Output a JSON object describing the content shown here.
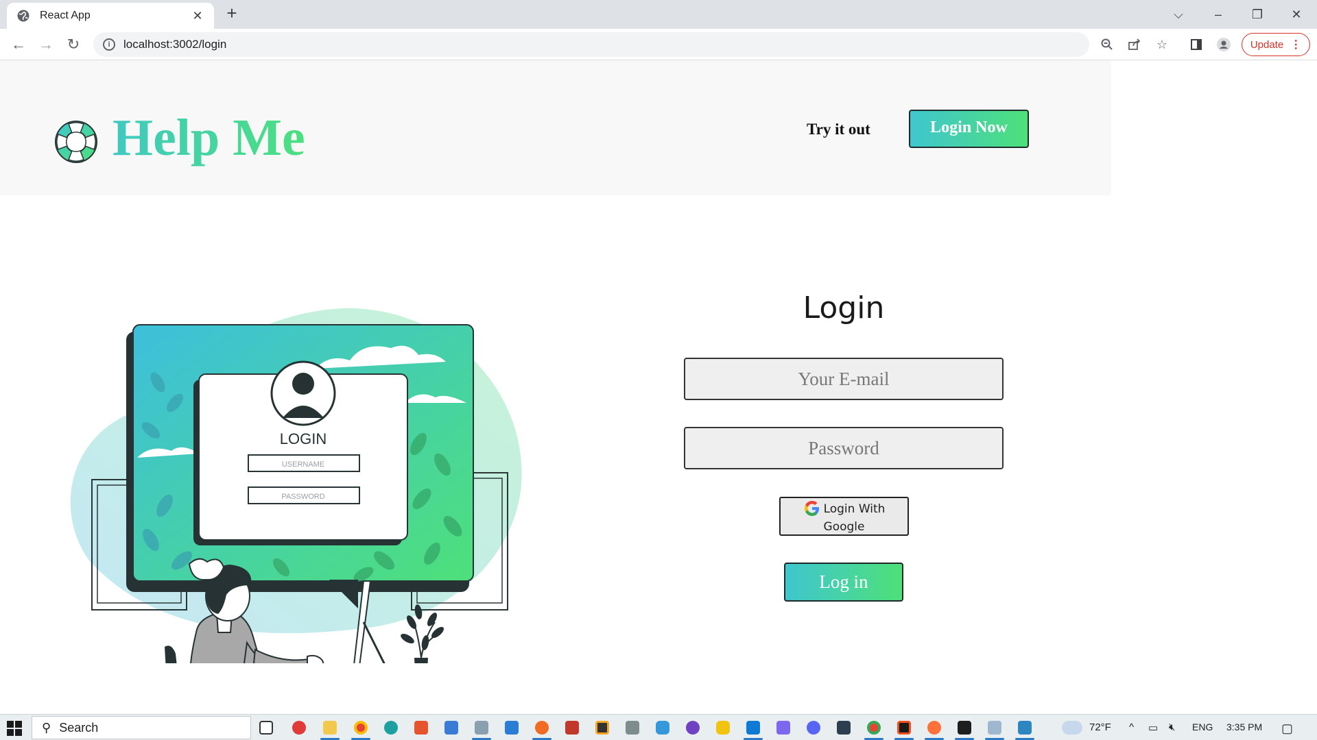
{
  "browser": {
    "tab_title": "React App",
    "new_tab": "+",
    "url": "localhost:3002/login",
    "update_label": "Update"
  },
  "header": {
    "brand": "Help Me",
    "try_link": "Try it out",
    "login_now": "Login Now"
  },
  "illustration": {
    "card_title": "LOGIN",
    "username_placeholder": "USERNAME",
    "password_placeholder": "PASSWORD"
  },
  "login_form": {
    "title": "Login",
    "email_placeholder": "Your E-mail",
    "password_placeholder": "Password",
    "google_button": "Login With Google",
    "submit_button": "Log in"
  },
  "taskbar": {
    "search_label": "Search",
    "weather": "72°F",
    "language": "ENG",
    "time": "3:35 PM"
  },
  "colors": {
    "accent_start": "#3fc6cf",
    "accent_end": "#4ee079",
    "update_red": "#d93025"
  }
}
